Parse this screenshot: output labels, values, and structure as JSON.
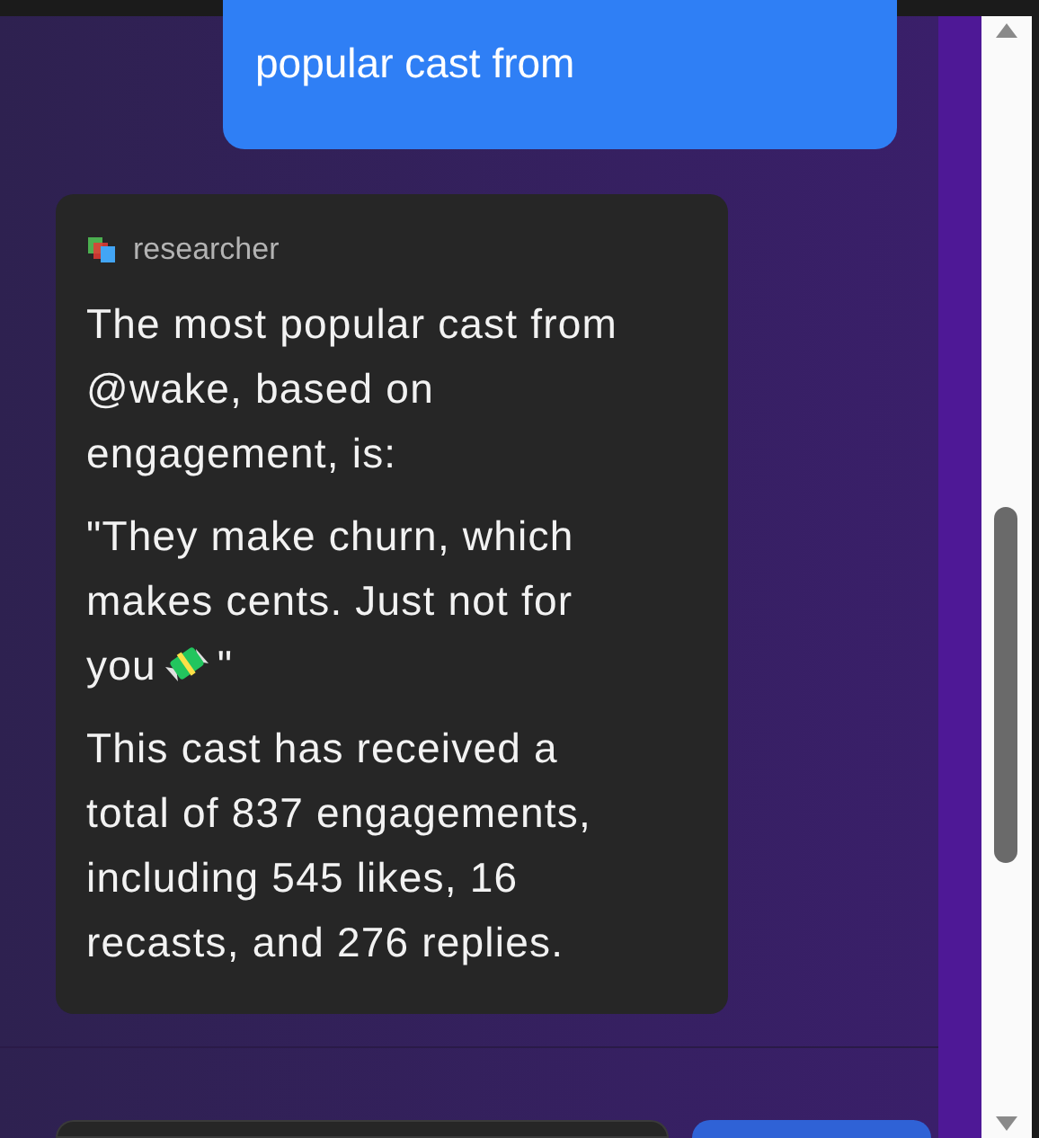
{
  "messages": [
    {
      "kind": "user",
      "text": "popular cast from"
    },
    {
      "kind": "bot",
      "author": "researcher",
      "paragraphs": [
        "The most popular cast from @wake, based on engagement, is:"
      ],
      "quote_before": "\"They make churn, which makes cents. Just not for you",
      "quote_after": "\"",
      "closing": "This cast has received a total of 837 engagements, including 545 likes, 16 recasts, and 276 replies."
    }
  ]
}
